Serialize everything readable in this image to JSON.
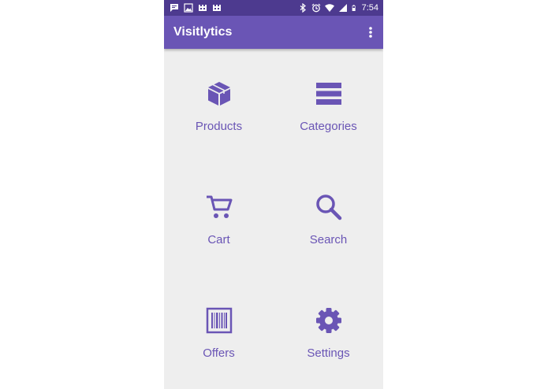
{
  "status_bar": {
    "time": "7:54",
    "left_icons": [
      "chat-notification-icon",
      "image-notification-icon",
      "game-notification-icon",
      "game-notification-icon"
    ],
    "right_icons": [
      "bluetooth-icon",
      "alarm-icon",
      "wifi-icon",
      "cellular-signal-icon",
      "battery-icon"
    ]
  },
  "app_bar": {
    "title": "Visitlytics",
    "overflow_icon": "more-vert-icon"
  },
  "menu": {
    "items": [
      {
        "label": "Products",
        "icon": "box-icon"
      },
      {
        "label": "Categories",
        "icon": "list-icon"
      },
      {
        "label": "Cart",
        "icon": "cart-icon"
      },
      {
        "label": "Search",
        "icon": "search-icon"
      },
      {
        "label": "Offers",
        "icon": "barcode-icon"
      },
      {
        "label": "Settings",
        "icon": "gear-icon"
      }
    ]
  },
  "colors": {
    "primary": "#6a55b5",
    "status_bar": "#4d3a8f",
    "background": "#eeeeee"
  }
}
